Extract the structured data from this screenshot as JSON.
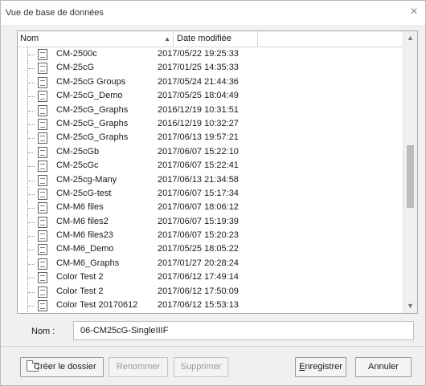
{
  "window": {
    "title": "Vue de base de données"
  },
  "list": {
    "columns": {
      "name": "Nom",
      "date": "Date modifiée"
    },
    "rows": [
      {
        "name": "CM-2500c",
        "date": "2017/05/22 19:25:33"
      },
      {
        "name": "CM-25cG",
        "date": "2017/01/25 14:35:33"
      },
      {
        "name": "CM-25cG Groups",
        "date": "2017/05/24 21:44:36"
      },
      {
        "name": "CM-25cG_Demo",
        "date": "2017/05/25 18:04:49"
      },
      {
        "name": "CM-25cG_Graphs",
        "date": "2016/12/19 10:31:51"
      },
      {
        "name": "CM-25cG_Graphs",
        "date": "2016/12/19 10:32:27"
      },
      {
        "name": "CM-25cG_Graphs",
        "date": "2017/06/13 19:57:21"
      },
      {
        "name": "CM-25cGb",
        "date": "2017/06/07 15:22:10"
      },
      {
        "name": "CM-25cGc",
        "date": "2017/06/07 15:22:41"
      },
      {
        "name": "CM-25cg-Many",
        "date": "2017/06/13 21:34:58"
      },
      {
        "name": "CM-25cG-test",
        "date": "2017/06/07 15:17:34"
      },
      {
        "name": "CM-M6 files",
        "date": "2017/06/07 18:06:12"
      },
      {
        "name": "CM-M6 files2",
        "date": "2017/06/07 15:19:39"
      },
      {
        "name": "CM-M6 files23",
        "date": "2017/06/07 15:20:23"
      },
      {
        "name": "CM-M6_Demo",
        "date": "2017/05/25 18:05:22"
      },
      {
        "name": "CM-M6_Graphs",
        "date": "2017/01/27 20:28:24"
      },
      {
        "name": "Color Test 2",
        "date": "2017/06/12 17:49:14"
      },
      {
        "name": "Color Test 2",
        "date": "2017/06/12 17:50:09"
      },
      {
        "name": "Color Test 20170612",
        "date": "2017/06/12 15:53:13"
      }
    ]
  },
  "form": {
    "name_label": "Nom :",
    "name_value": "06-CM25cG-SingleIIIF"
  },
  "buttons": {
    "create_folder": "Créer le dossier",
    "rename": "Renommer",
    "delete": "Supprimer",
    "save_first": "E",
    "save_rest": "nregistrer",
    "cancel": "Annuler"
  },
  "icons": {
    "close": "close-icon",
    "sort_ascending": "sort-up-icon",
    "file": "file-icon",
    "folder": "new-folder-icon",
    "scroll_up": "scroll-up-icon",
    "scroll_down": "scroll-down-icon"
  }
}
